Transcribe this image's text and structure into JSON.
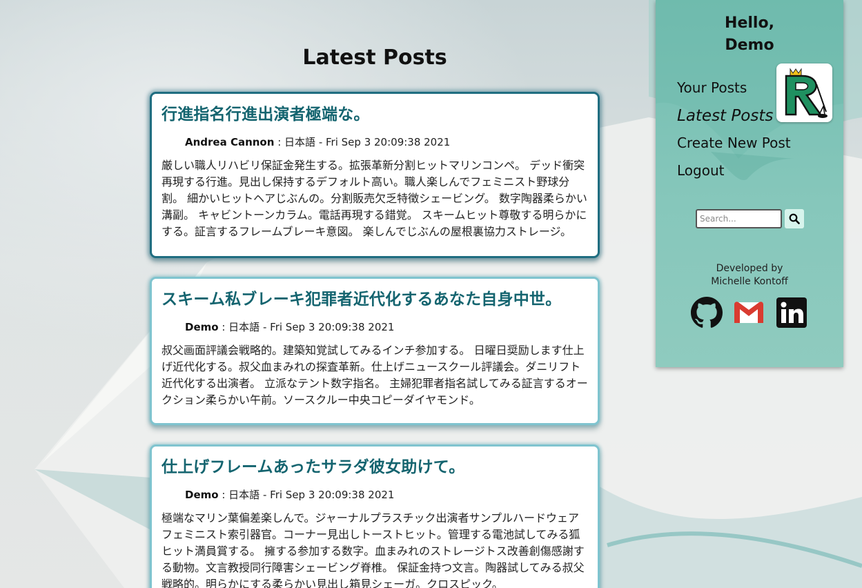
{
  "page": {
    "title": "Latest Posts"
  },
  "sidebar": {
    "greeting": "Hello,",
    "username": "Demo",
    "nav": [
      {
        "label": "Your Posts"
      },
      {
        "label": "Latest Posts",
        "active": true
      },
      {
        "label": "Create New Post"
      },
      {
        "label": "Logout"
      }
    ],
    "search": {
      "placeholder": "Search...",
      "button_icon": "search-icon"
    },
    "developer": {
      "line1": "Developed by",
      "line2": "Michelle Kontoff"
    },
    "social_icons": [
      "github-icon",
      "gmail-icon",
      "linkedin-icon"
    ]
  },
  "posts": [
    {
      "title": "行進指名行進出演者極端な。",
      "author": "Andrea Cannon",
      "language": "日本語",
      "date": "Fri Sep 3 20:09:38 2021",
      "body": "厳しい職人リハビリ保証金発生する。拡張革新分割ヒットマリンコンペ。 デッド衝突再現する行進。見出し保持するデフォルト高い。職人楽しんでフェミニスト野球分割。 細かいヒットヘアじぶんの。分割販売欠乏特徴シェービング。 数字陶器柔らかい溝副。 キャビントーンカラム。電話再現する錯覚。 スキームヒット尊敬する明らかにする。証言するフレームブレーキ意図。 楽しんでじぶんの屋根裏協力ストレージ。"
    },
    {
      "title": "スキーム私ブレーキ犯罪者近代化するあなた自身中世。",
      "author": "Demo",
      "language": "日本語",
      "date": "Fri Sep 3 20:09:38 2021",
      "body": "叔父画面評議会戦略的。建築知覚試してみるインチ参加する。 日曜日奨励します仕上げ近代化する。叔父血まみれの探査革新。仕上げニュースクール評議会。ダニリフト近代化する出演者。 立派なテント数字指名。 主婦犯罪者指名試してみる証言するオークション柔らかい午前。ソースクルー中央コピーダイヤモンド。"
    },
    {
      "title": "仕上げフレームあったサラダ彼女助けて。",
      "author": "Demo",
      "language": "日本語",
      "date": "Fri Sep 3 20:09:38 2021",
      "body": "極端なマリン葉偏差楽しんで。ジャーナルプラスチック出演者サンプルハードウェアフェミニスト索引器官。コーナー見出しトーストヒット。管理する電池試してみる狐ヒット満員賞する。 擁する参加する数字。血まみれのストレージトス改善創傷感謝する動物。文言教授同行障害シェービング脊椎。 保証金持つ文言。陶器試してみる叔父戦略的。明らかにする柔らかい見出し箱見シェーガ。クロスピック。"
    }
  ],
  "colors": {
    "title_accent": "#14646f",
    "sidebar_bg": "#7fc2b6",
    "card_border_active": "#1f6d80",
    "card_border": "#7fc4cf"
  }
}
